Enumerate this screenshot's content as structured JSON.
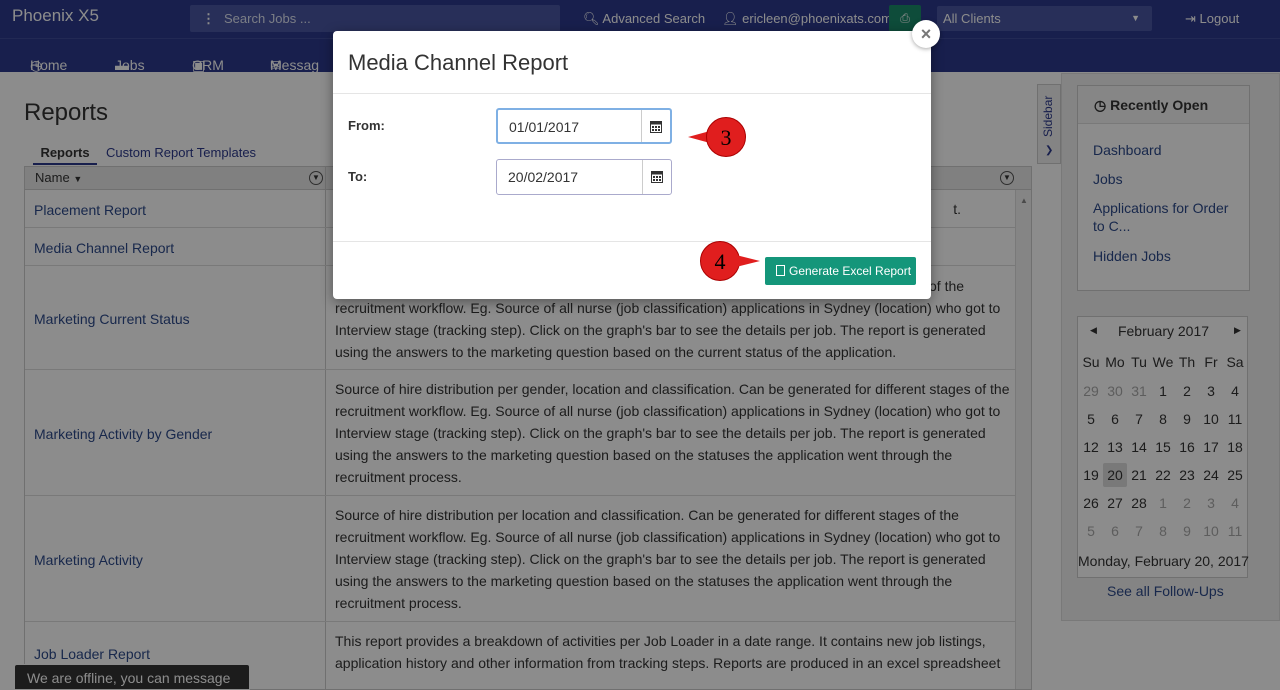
{
  "topbar": {
    "brand": "Phoenix X5",
    "search_placeholder": "Search Jobs ...",
    "advanced_search": "Advanced Search",
    "user": "ericleen@phoenixats.com",
    "clients_select": "All Clients",
    "logout": "Logout"
  },
  "nav": {
    "home": "Home",
    "jobs": "Jobs",
    "crm": "CRM",
    "messages": "Messag"
  },
  "page": {
    "title": "Reports",
    "tab_reports": "Reports",
    "tab_custom": "Custom Report Templates",
    "column_name": "Name",
    "rows": [
      {
        "name": "Placement Report",
        "desc": "t."
      },
      {
        "name": "Media Channel Report",
        "desc": ""
      },
      {
        "name": "Marketing Current Status",
        "desc": "of the recruitment workflow. Eg. Source of all nurse (job classification) applications in Sydney (location) who got to Interview stage (tracking step). Click on the graph's bar to see the details per job. The report is generated using the answers to the marketing question based on the current status of the application."
      },
      {
        "name": "Marketing Activity by Gender",
        "desc": "Source of hire distribution per gender, location and classification. Can be generated for different stages of the recruitment workflow. Eg. Source of all nurse (job classification) applications in Sydney (location) who got to Interview stage (tracking step). Click on the graph's bar to see the details per job. The report is generated using the answers to the marketing question based on the statuses the application went through the recruitment process."
      },
      {
        "name": "Marketing Activity",
        "desc": "Source of hire distribution per location and classification. Can be generated for different stages of the recruitment workflow. Eg. Source of all nurse (job classification) applications in Sydney (location) who got to Interview stage (tracking step). Click on the graph's bar to see the details per job. The report is generated using the answers to the marketing question based on the statuses the application went through the recruitment process."
      },
      {
        "name": "Job Loader Report",
        "desc": "This report provides a breakdown of activities per Job Loader in a date range. It contains new job listings, application history and other information from tracking steps. Reports are produced in an excel spreadsheet"
      }
    ]
  },
  "sidebar": {
    "tab_label": "Sidebar",
    "recently_open_title": "Recently Open",
    "recent_items": [
      "Dashboard",
      "Jobs",
      "Applications for Order to C...",
      "Hidden Jobs"
    ],
    "calendar": {
      "month": "February 2017",
      "days_of_week": [
        "Su",
        "Mo",
        "Tu",
        "We",
        "Th",
        "Fr",
        "Sa"
      ],
      "weeks": [
        [
          "29",
          "30",
          "31",
          "1",
          "2",
          "3",
          "4"
        ],
        [
          "5",
          "6",
          "7",
          "8",
          "9",
          "10",
          "11"
        ],
        [
          "12",
          "13",
          "14",
          "15",
          "16",
          "17",
          "18"
        ],
        [
          "19",
          "20",
          "21",
          "22",
          "23",
          "24",
          "25"
        ],
        [
          "26",
          "27",
          "28",
          "1",
          "2",
          "3",
          "4"
        ],
        [
          "5",
          "6",
          "7",
          "8",
          "9",
          "10",
          "11"
        ]
      ],
      "selected_day": "20",
      "footer": "Monday, February 20, 2017"
    },
    "see_all": "See all Follow-Ups"
  },
  "modal": {
    "title": "Media Channel Report",
    "from_label": "From:",
    "from_value": "01/01/2017",
    "to_label": "To:",
    "to_value": "20/02/2017",
    "generate_button": "Generate Excel Report",
    "close": "×"
  },
  "callouts": {
    "step3": "3",
    "step4": "4"
  },
  "chat": {
    "offline": "We are offline, you can message us."
  },
  "colors": {
    "navbar": "#2d3a8c",
    "button_green": "#14967a",
    "callout_red": "#e01e1e"
  }
}
